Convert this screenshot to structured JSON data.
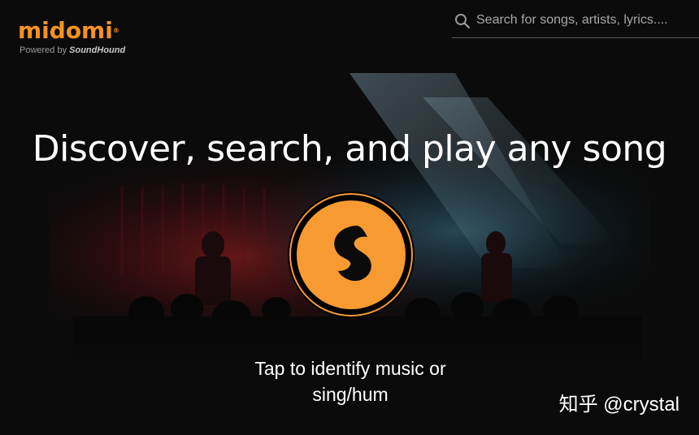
{
  "header": {
    "logo_text": "midomi",
    "logo_mark": "®",
    "powered_by_prefix": "Powered by ",
    "powered_by_brand": "SoundHound"
  },
  "search": {
    "placeholder": "Search for songs, artists, lyrics....",
    "value": "",
    "icon": "search-icon"
  },
  "hero": {
    "headline": "Discover, search, and play any song",
    "cta_line1": "Tap to identify music or",
    "cta_line2": "sing/hum",
    "button_icon": "soundhound-icon"
  },
  "watermark": "知乎 @crystal",
  "colors": {
    "brand_orange": "#f6931e",
    "button_orange": "#f79a31",
    "background": "#0b0b0b"
  }
}
